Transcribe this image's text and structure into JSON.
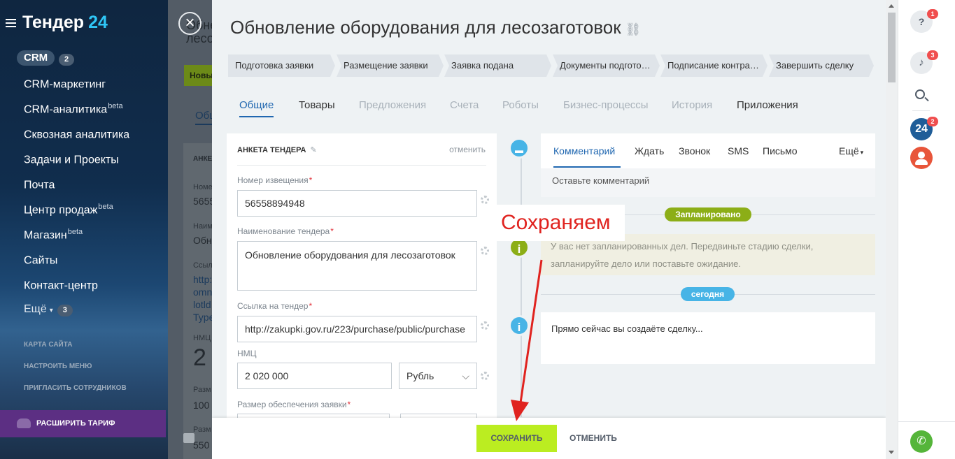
{
  "sidebar": {
    "logo": "Тендер",
    "logo_num": "24",
    "crm": "CRM",
    "crm_count": "2",
    "items": [
      {
        "label": "CRM-маркетинг",
        "sup": ""
      },
      {
        "label": "CRM-аналитика",
        "sup": "beta"
      },
      {
        "label": "Сквозная аналитика",
        "sup": ""
      },
      {
        "label": "Задачи и Проекты",
        "sup": ""
      },
      {
        "label": "Почта",
        "sup": ""
      },
      {
        "label": "Центр продаж",
        "sup": "beta"
      },
      {
        "label": "Магазин",
        "sup": "beta"
      },
      {
        "label": "Сайты",
        "sup": ""
      },
      {
        "label": "Контакт-центр",
        "sup": ""
      }
    ],
    "more": "Ещё",
    "more_count": "3",
    "links": [
      "КАРТА САЙТА",
      "НАСТРОИТЬ МЕНЮ",
      "ПРИГЛАСИТЬ СОТРУДНИКОВ"
    ],
    "upgrade": "РАСШИРИТЬ ТАРИФ"
  },
  "bg": {
    "title_cut": "Обне",
    "title_cut2": "лесо",
    "green_btn": "Новы",
    "tab": "Обш",
    "card": "АНКЕ",
    "rows": [
      "Номе",
      "5655",
      "Наим",
      "Обн",
      "Ссыл",
      "http:",
      "omn",
      "lotld",
      "Type",
      "НМЦ",
      "2",
      "Разм",
      "100",
      "Разм",
      "550"
    ]
  },
  "deal": {
    "title": "Обновление оборудования для лесозаготовок",
    "stages": [
      "Подготовка заявки",
      "Размещение заявки",
      "Заявка подана",
      "Документы подгото…",
      "Подписание контра…",
      "Завершить сделку"
    ],
    "tabs": [
      "Общие",
      "Товары",
      "Предложения",
      "Счета",
      "Роботы",
      "Бизнес-процессы",
      "История",
      "Приложения"
    ]
  },
  "form": {
    "title": "АНКЕТА ТЕНДЕРА",
    "cancel": "отменить",
    "fields": [
      {
        "label": "Номер извещения",
        "value": "56558894948"
      },
      {
        "label": "Наименование тендера",
        "value": "Обновление оборудования для лесозаготовок"
      },
      {
        "label": "Ссылка на тендер",
        "value": "http://zakupki.gov.ru/223/purchase/public/purchase"
      },
      {
        "label": "НМЦ",
        "value": "2 020 000",
        "currency": "Рубль"
      },
      {
        "label": "Размер обеспечения заявки",
        "value": ""
      }
    ]
  },
  "activity": {
    "tabs": [
      "Комментарий",
      "Ждать",
      "Звонок",
      "SMS",
      "Письмо"
    ],
    "more": "Ещё",
    "placeholder": "Оставьте комментарий",
    "planned_pill": "Запланировано",
    "planned_text_1": "У вас нет запланированных дел. Передвиньте стадию сделки,",
    "planned_text_2": "запланируйте дело или поставьте ожидание.",
    "today_pill": "сегодня",
    "now_text": "Прямо сейчас вы создаёте сделку..."
  },
  "footer": {
    "save": "СОХРАНИТЬ",
    "cancel": "ОТМЕНИТЬ"
  },
  "annotation": "Сохраняем",
  "right_panel": {
    "help_badge": "1",
    "bell_badge": "3",
    "b24_label": "24",
    "b24_badge": "2"
  },
  "colors": {
    "accent": "#2067b0",
    "save": "#bbed21",
    "planned": "#8cae17",
    "today": "#47b4e6",
    "annot": "#e0231f"
  }
}
